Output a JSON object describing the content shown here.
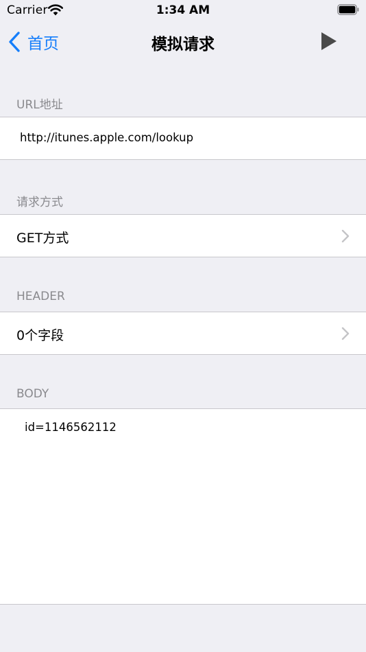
{
  "status_bar": {
    "carrier": "Carrier",
    "time": "1:34 AM",
    "wifi_icon": "wifi-icon",
    "battery_icon": "battery-full-icon"
  },
  "nav": {
    "back_label": "首页",
    "title": "模拟请求",
    "run_icon": "play-icon",
    "tint_color": "#157efb"
  },
  "sections": {
    "url": {
      "header": "URL地址",
      "value": "http://itunes.apple.com/lookup"
    },
    "method": {
      "header": "请求方式",
      "value": "GET方式",
      "accessory": "chevron-right-icon"
    },
    "header": {
      "header": "HEADER",
      "value": "0个字段",
      "accessory": "chevron-right-icon"
    },
    "body": {
      "header": "BODY",
      "value": "id=1146562112"
    }
  },
  "colors": {
    "background": "#efeff4",
    "section_header_text": "#8a8a8e",
    "separator": "#c8c7cc"
  }
}
